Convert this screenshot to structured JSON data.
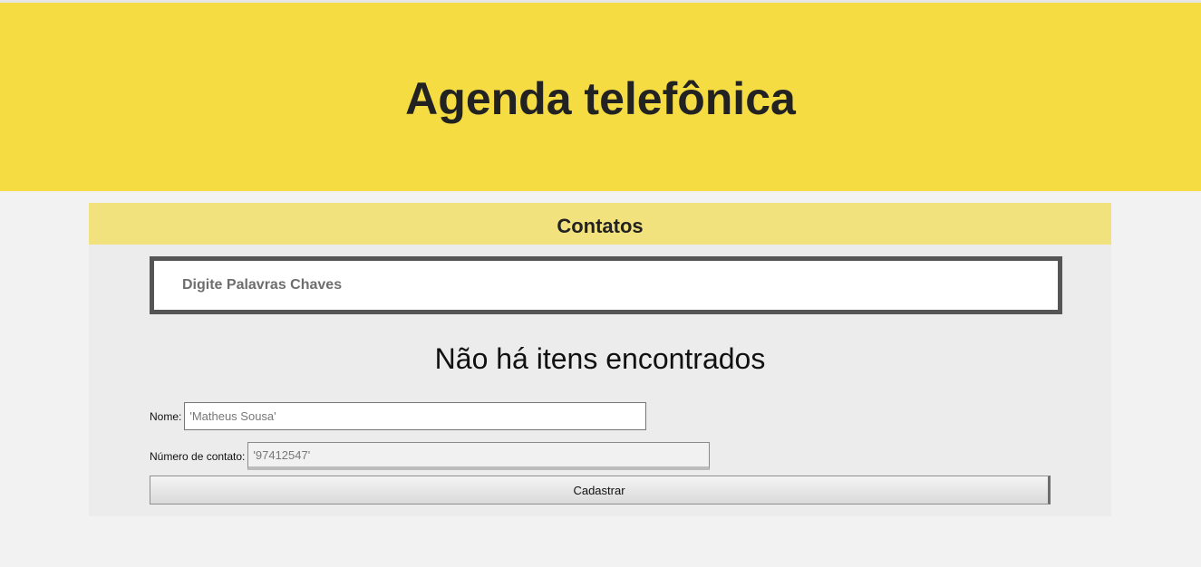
{
  "header": {
    "title": "Agenda telefônica"
  },
  "contacts_panel": {
    "title": "Contatos",
    "search": {
      "placeholder": "Digite Palavras Chaves",
      "value": ""
    },
    "empty_message": "Não há itens encontrados"
  },
  "form": {
    "name_label": "Nome:",
    "name_placeholder": "'Matheus Sousa'",
    "name_value": "",
    "phone_label": "Número de contato:",
    "phone_placeholder": "'97412547'",
    "phone_value": "",
    "submit_label": "Cadastrar"
  },
  "colors": {
    "header_bg": "#f5dc43",
    "panel_title_bg": "#f2e27e",
    "panel_bg": "#ececec",
    "page_bg": "#f2f2f2",
    "search_border": "#555555"
  }
}
